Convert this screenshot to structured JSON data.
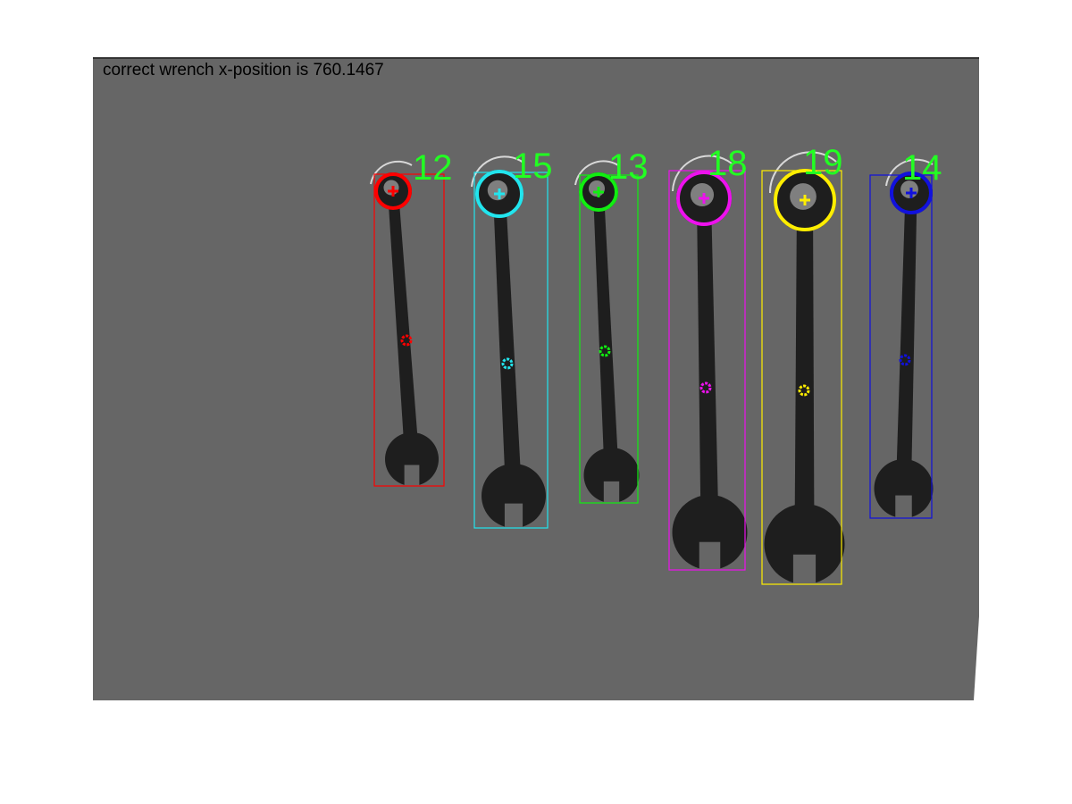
{
  "figure": {
    "caption": "correct wrench x-position is 760.1467",
    "background_color": "#666666",
    "wrench_color": "#1e1e1e",
    "label_color": "#22ff22"
  },
  "wrenches": [
    {
      "size": "12",
      "marker_color": "#ff0000"
    },
    {
      "size": "15",
      "marker_color": "#22e5ee"
    },
    {
      "size": "13",
      "marker_color": "#11ee11"
    },
    {
      "size": "18",
      "marker_color": "#ee11ee"
    },
    {
      "size": "19",
      "marker_color": "#ffee00"
    },
    {
      "size": "14",
      "marker_color": "#1111dd"
    }
  ]
}
